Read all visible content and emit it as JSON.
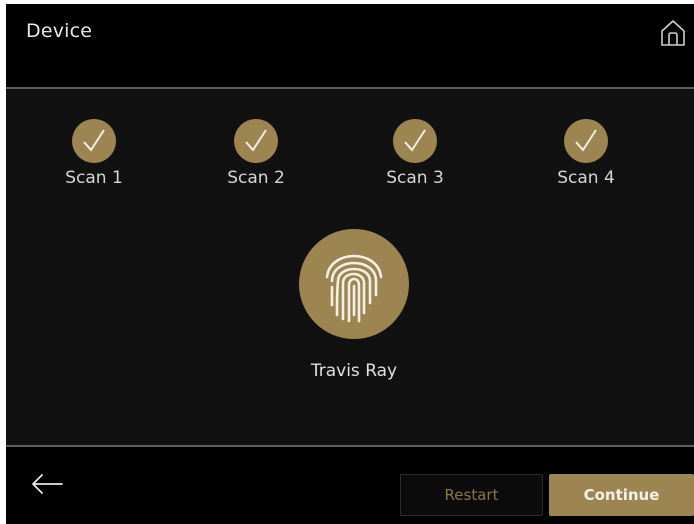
{
  "header": {
    "title": "Device",
    "home_icon": "home-icon"
  },
  "scans": [
    {
      "label": "Scan 1",
      "status": "complete",
      "icon": "check-icon"
    },
    {
      "label": "Scan 2",
      "status": "complete",
      "icon": "check-icon"
    },
    {
      "label": "Scan 3",
      "status": "complete",
      "icon": "check-icon"
    },
    {
      "label": "Scan 4",
      "status": "complete",
      "icon": "check-icon"
    }
  ],
  "fingerprint": {
    "icon": "fingerprint-icon",
    "user_name": "Travis Ray"
  },
  "footer": {
    "back_icon": "arrow-left-icon",
    "restart_label": "Restart",
    "continue_label": "Continue"
  },
  "colors": {
    "accent": "#9c8551",
    "background": "#111111",
    "header_background": "#000000"
  }
}
